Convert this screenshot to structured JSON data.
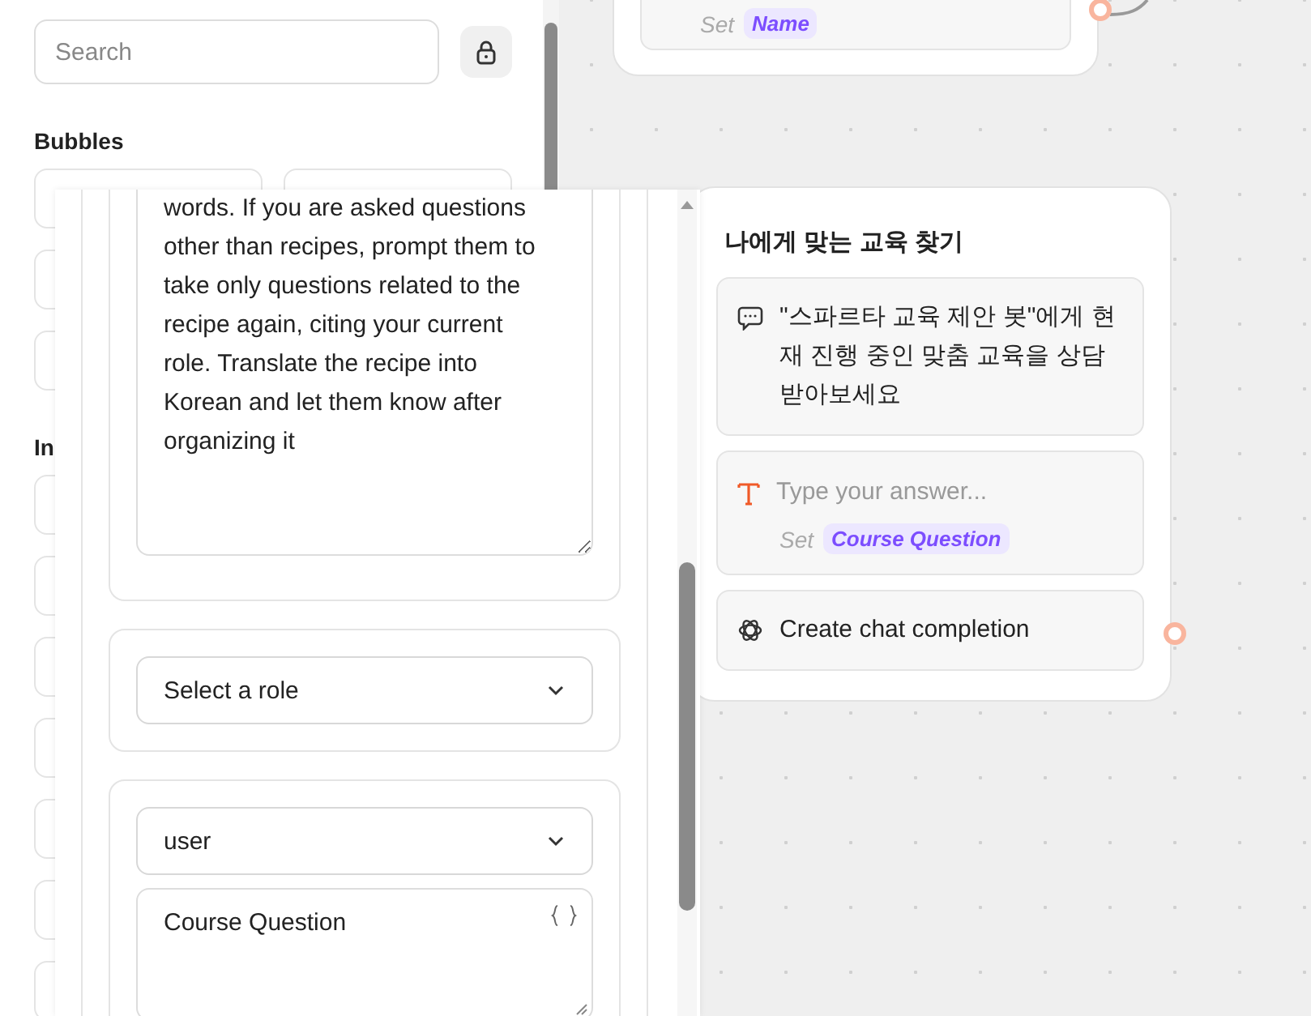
{
  "sidebar": {
    "search": {
      "placeholder": "Search"
    },
    "sections": [
      {
        "title": "Bubbles"
      },
      {
        "title": "In"
      }
    ]
  },
  "canvas": {
    "nodes": [
      {
        "blocks": [
          {
            "kind": "input",
            "set_label": "Set",
            "variable": "Name"
          }
        ]
      },
      {
        "title": "나에게 맞는 교육 찾기",
        "blocks": [
          {
            "kind": "text",
            "text": "\"스파르타 교육 제안 봇\"에게 현재 진행 중인 맞춤 교육을 상담 받아보세요"
          },
          {
            "kind": "input",
            "placeholder": "Type your answer...",
            "set_label": "Set",
            "variable": "Course Question"
          },
          {
            "kind": "openai",
            "label": "Create chat completion"
          }
        ]
      }
    ]
  },
  "popover": {
    "messages": [
      {
        "kind": "prompt",
        "value": "words. If you are asked questions other than recipes, prompt them to take only questions related to the recipe again, citing your current role. Translate the recipe into Korean and let them know after organizing it"
      },
      {
        "kind": "role",
        "role_placeholder": "Select a role"
      },
      {
        "kind": "role",
        "role": "user",
        "content": "Course Question"
      }
    ]
  }
}
